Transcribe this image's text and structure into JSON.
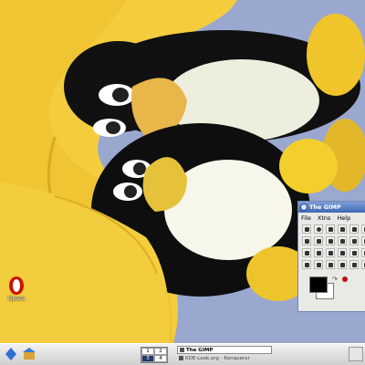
{
  "desktop": {
    "wallpaper": "plush-penguins-photo",
    "icons": [
      {
        "label": "Opera",
        "icon": "opera-icon",
        "color": "#cc1100"
      }
    ]
  },
  "gimp_toolbox": {
    "title": "The GIMP",
    "menus": [
      "File",
      "Xtns",
      "Help"
    ],
    "tools": [
      "rect-select-icon",
      "ellipse-select-icon",
      "lasso-icon",
      "magic-wand-icon",
      "bezier-select-icon",
      "scissors-icon",
      "fuzzy-select-icon",
      "move-icon",
      "crop-icon",
      "transform-icon",
      "flip-icon",
      "text-icon",
      "color-picker-icon",
      "bucket-fill-icon",
      "blend-icon",
      "pencil-icon",
      "paintbrush-icon",
      "eraser-icon",
      "airbrush-icon",
      "ink-icon",
      "clone-icon",
      "convolve-icon",
      "smudge-icon",
      "measure-icon"
    ],
    "colors": {
      "foreground": "#000000",
      "background": "#ffffff"
    }
  },
  "taskbar": {
    "launchers": [
      "kde-menu-icon",
      "home-folder-icon"
    ],
    "pager": [
      "1",
      "2",
      "3",
      "4"
    ],
    "active_desktop": "3",
    "tasks": [
      {
        "label": "The GIMP",
        "active": true
      },
      {
        "label": "KDE-Look.org - Konqueror",
        "active": false
      }
    ]
  }
}
